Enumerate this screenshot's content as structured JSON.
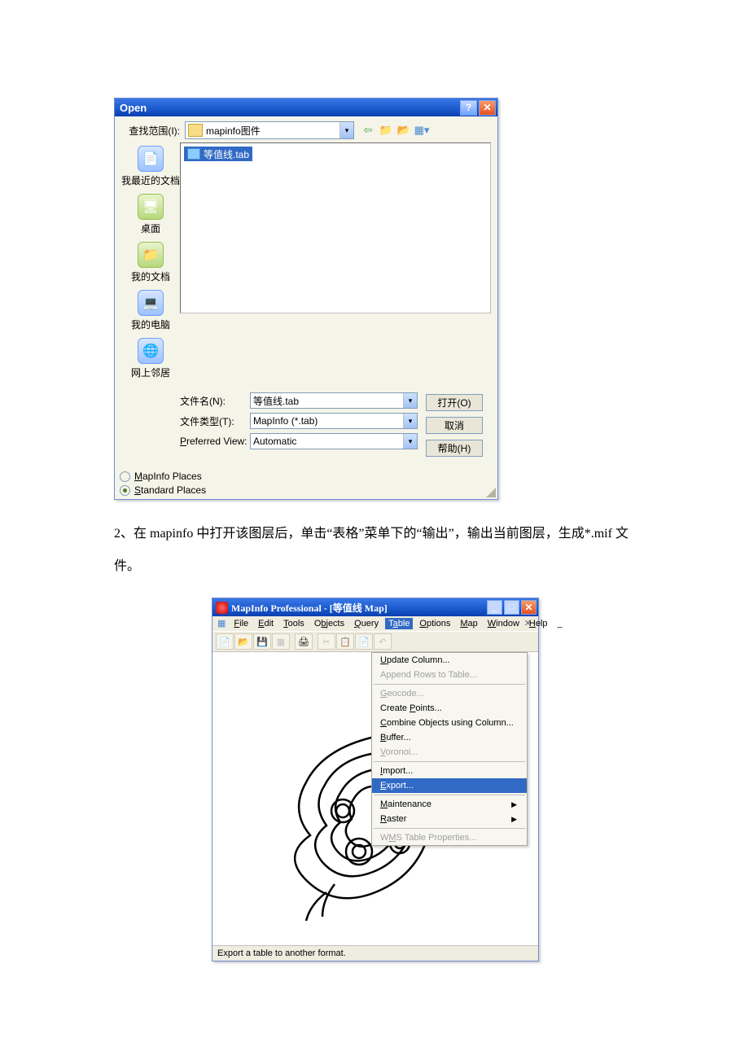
{
  "open_dialog": {
    "title": "Open",
    "look_in_label": "查找范围(I):",
    "look_in_value": "mapinfo图件",
    "sidebar": [
      {
        "label": "我最近的文档"
      },
      {
        "label": "桌面"
      },
      {
        "label": "我的文档"
      },
      {
        "label": "我的电脑"
      },
      {
        "label": "网上邻居"
      }
    ],
    "file_item": "等值线.tab",
    "filename_label": "文件名(N):",
    "filename_value": "等值线.tab",
    "filetype_label": "文件类型(T):",
    "filetype_value": "MapInfo (*.tab)",
    "prefview_label": "Preferred View:",
    "prefview_value": "Automatic",
    "open_btn": "打开(O)",
    "cancel_btn": "取消",
    "help_btn": "帮助(H)",
    "places_m": "MapInfo Places",
    "places_s": "Standard Places"
  },
  "body_text": "2、在 mapinfo 中打开该图层后，单击“表格”菜单下的“输出”，输出当前图层，生成*.mif 文件。",
  "app_window": {
    "title": "MapInfo Professional - [等值线 Map]",
    "menus": [
      "File",
      "Edit",
      "Tools",
      "Objects",
      "Query",
      "Table",
      "Options",
      "Map",
      "Window",
      "Help",
      "_"
    ],
    "table_menu": {
      "items": [
        {
          "label": "Update Column...",
          "enabled": true
        },
        {
          "label": "Append Rows to Table...",
          "enabled": false
        },
        {
          "sep": true
        },
        {
          "label": "Geocode...",
          "enabled": false
        },
        {
          "label": "Create Points...",
          "enabled": true
        },
        {
          "label": "Combine Objects using Column...",
          "enabled": true
        },
        {
          "label": "Buffer...",
          "enabled": true
        },
        {
          "label": "Voronoi...",
          "enabled": false
        },
        {
          "sep": true
        },
        {
          "label": "Import...",
          "enabled": true
        },
        {
          "label": "Export...",
          "enabled": true,
          "highlight": true
        },
        {
          "sep": true
        },
        {
          "label": "Maintenance",
          "enabled": true,
          "submenu": true
        },
        {
          "label": "Raster",
          "enabled": true,
          "submenu": true
        },
        {
          "sep": true
        },
        {
          "label": "WMS Table Properties...",
          "enabled": false
        }
      ]
    },
    "status": "Export a table to another format."
  }
}
